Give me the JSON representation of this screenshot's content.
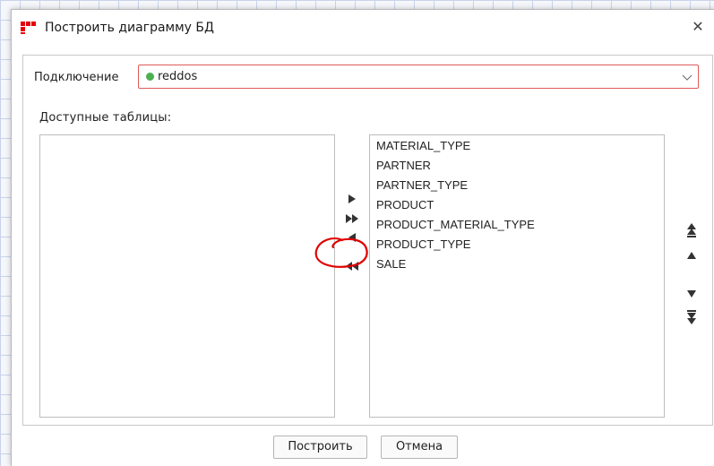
{
  "window": {
    "title": "Построить диаграмму БД",
    "close_glyph": "✕"
  },
  "connection": {
    "label": "Подключение",
    "value": "reddos",
    "status_color": "#4caf50",
    "error_border_color": "#e05a5a"
  },
  "available": {
    "label": "Доступные таблицы:",
    "items": []
  },
  "selected": {
    "items": [
      "MATERIAL_TYPE",
      "PARTNER",
      "PARTNER_TYPE",
      "PRODUCT",
      "PRODUCT_MATERIAL_TYPE",
      "PRODUCT_TYPE",
      "SALE"
    ]
  },
  "transfer_buttons": [
    "move-right-icon",
    "move-all-right-icon",
    "move-left-icon",
    "move-all-left-icon"
  ],
  "order_buttons": [
    "move-top-icon",
    "move-up-icon",
    "move-down-icon",
    "move-bottom-icon"
  ],
  "buttons": {
    "build": "Построить",
    "cancel": "Отмена"
  },
  "annotation": {
    "color": "#e00000",
    "target": "move-all-right-icon"
  }
}
